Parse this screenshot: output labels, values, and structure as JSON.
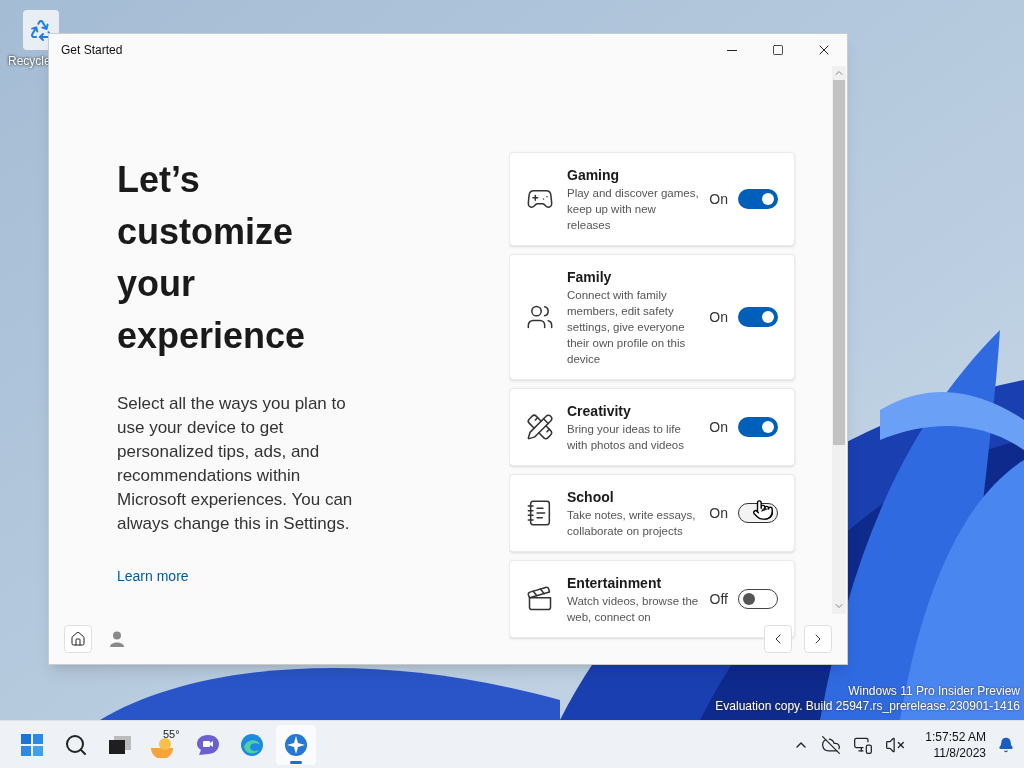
{
  "desktop": {
    "icons": [
      {
        "label": "Recycle"
      }
    ],
    "watermark": [
      "Windows 11 Pro Insider Preview",
      "Evaluation copy. Build 25947.rs_prerelease.230901-1416"
    ]
  },
  "window": {
    "title": "Get Started",
    "heading": "Let’s customize your experience",
    "body": "Select all the ways you plan to use your device to get personalized tips, ads, and recommendations within Microsoft experiences. You can always change this in Settings.",
    "link": "Learn more",
    "options": [
      {
        "kind": "gaming",
        "title": "Gaming",
        "description": "Play and discover games, keep up with new releases",
        "state_label": "On",
        "on": true,
        "pressed": false
      },
      {
        "kind": "family",
        "title": "Family",
        "description": "Connect with family members, edit safety settings, give everyone their own profile on this device",
        "state_label": "On",
        "on": true,
        "pressed": false
      },
      {
        "kind": "creativity",
        "title": "Creativity",
        "description": "Bring your ideas to life with photos and videos",
        "state_label": "On",
        "on": true,
        "pressed": false
      },
      {
        "kind": "school",
        "title": "School",
        "description": "Take notes, write essays, collaborate on projects",
        "state_label": "On",
        "on": true,
        "pressed": true
      },
      {
        "kind": "entertainment",
        "title": "Entertainment",
        "description": "Watch videos, browse the web, connect on",
        "state_label": "Off",
        "on": false,
        "pressed": false
      }
    ]
  },
  "taskbar": {
    "apps": [
      {
        "kind": "start",
        "selected": false
      },
      {
        "kind": "search",
        "selected": false
      },
      {
        "kind": "taskview",
        "selected": false
      },
      {
        "kind": "weather",
        "selected": false,
        "label": "55°"
      },
      {
        "kind": "chat",
        "selected": false
      },
      {
        "kind": "browser",
        "selected": false
      },
      {
        "kind": "getstarted",
        "selected": true
      }
    ],
    "time": "1:57:52 AM",
    "date": "11/8/2023"
  }
}
